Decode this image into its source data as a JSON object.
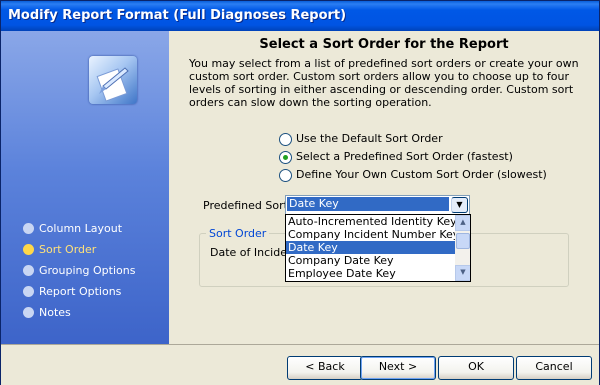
{
  "window": {
    "title": "Modify Report Format (Full Diagnoses Report)"
  },
  "sidebar": {
    "steps": [
      {
        "label": "Column Layout",
        "active": false
      },
      {
        "label": "Sort Order",
        "active": true
      },
      {
        "label": "Grouping Options",
        "active": false
      },
      {
        "label": "Report Options",
        "active": false
      },
      {
        "label": "Notes",
        "active": false
      }
    ]
  },
  "main": {
    "heading": "Select a Sort Order for the Report",
    "description": "You may select from a list of predefined sort orders or create your own custom sort order. Custom sort orders allow you to choose up to four levels of sorting in either ascending or descending order. Custom sort orders can slow down the sorting operation.",
    "options": [
      {
        "label": "Use the Default Sort Order",
        "checked": false
      },
      {
        "label": "Select a Predefined Sort Order (fastest)",
        "checked": true
      },
      {
        "label": "Define Your Own Custom Sort Order (slowest)",
        "checked": false
      }
    ],
    "predefined_sort": {
      "label": "Predefined Sort:",
      "value": "Date Key",
      "items": [
        "Auto-Incremented Identity Key",
        "Company Incident Number Key",
        "Date Key",
        "Company Date Key",
        "Employee Date Key"
      ],
      "selected_index": 2
    },
    "sort_order": {
      "legend": "Sort Order",
      "value": "Date of Incident"
    }
  },
  "footer": {
    "back_label": "< Back",
    "next_label": "Next >",
    "ok_label": "OK",
    "cancel_label": "Cancel"
  }
}
